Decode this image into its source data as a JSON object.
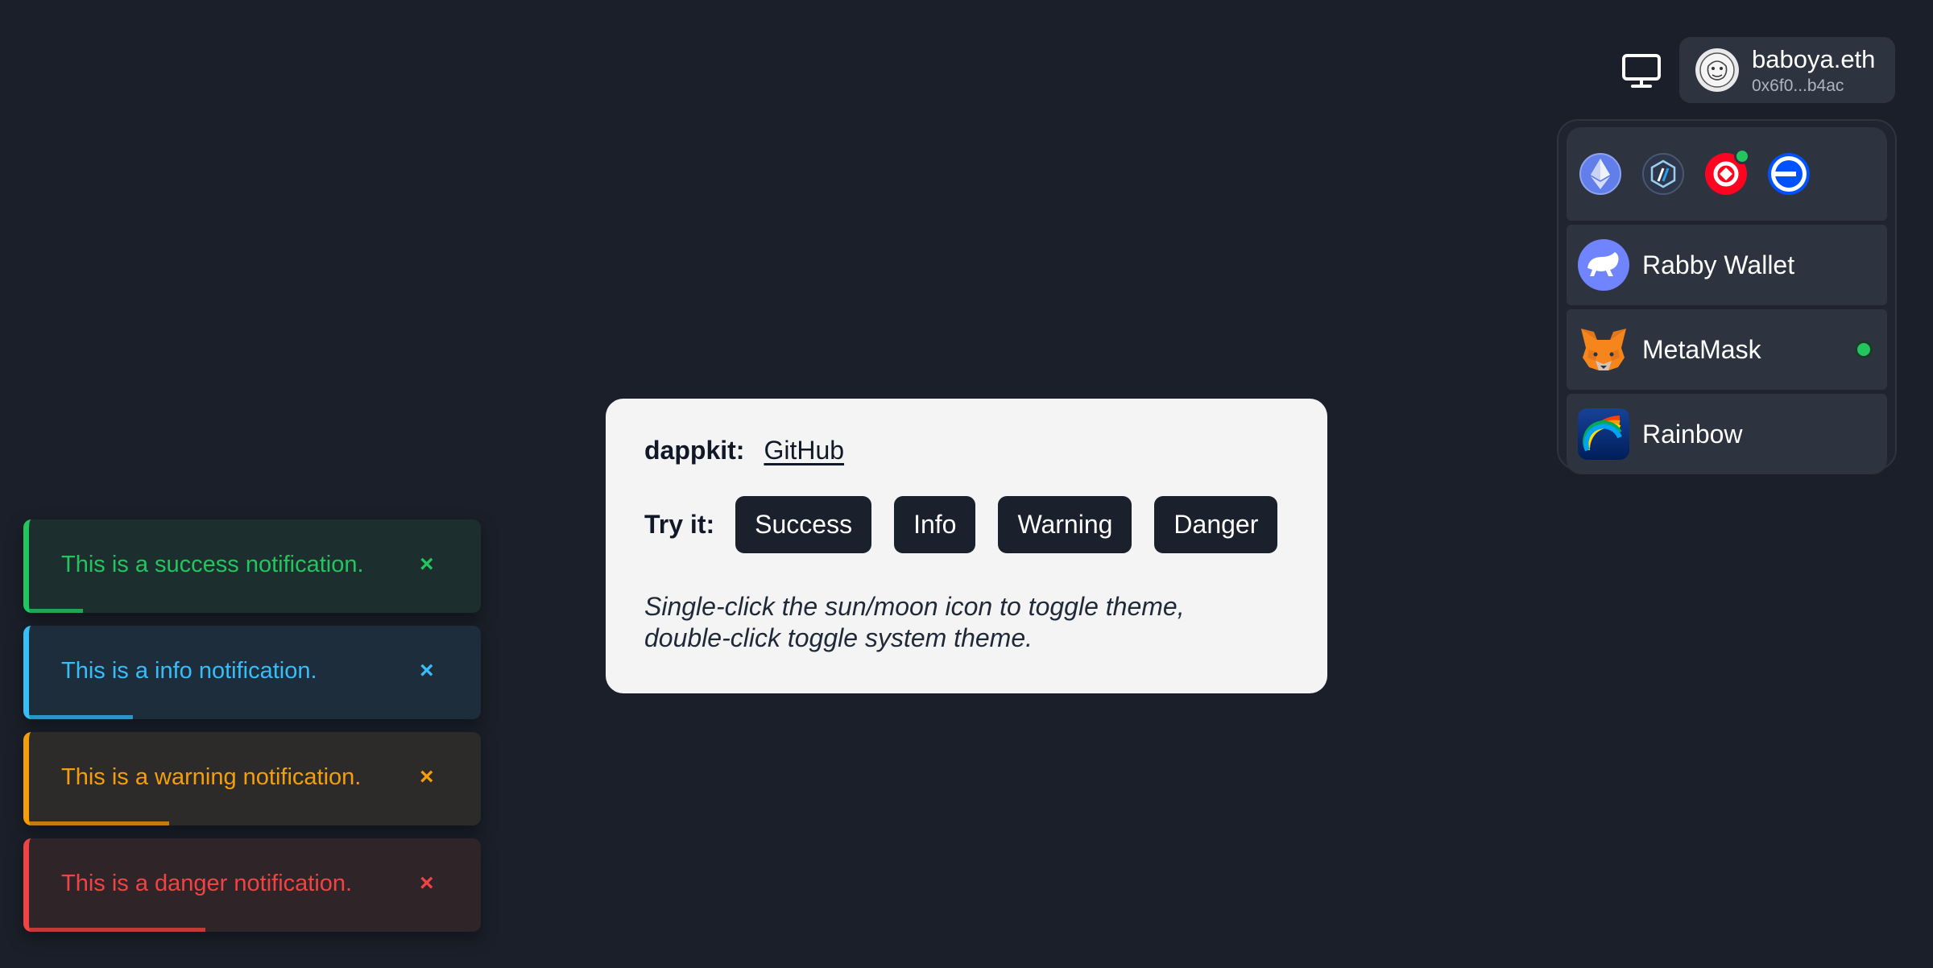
{
  "header": {
    "display_icon": "monitor-icon",
    "account": {
      "name": "baboya.eth",
      "address": "0x6f0...b4ac",
      "avatar_icon": "avatar-icon"
    }
  },
  "wallet_panel": {
    "chains": [
      {
        "name": "ethereum-icon",
        "color": "#627eea",
        "active": false
      },
      {
        "name": "arbitrum-icon",
        "color": "#2d374b",
        "active": false
      },
      {
        "name": "optimism-icon",
        "color": "#ff0420",
        "active": true
      },
      {
        "name": "base-icon",
        "color": "#0052ff",
        "active": false
      }
    ],
    "wallets": [
      {
        "label": "Rabby Wallet",
        "icon": "rabby-icon",
        "connected": false
      },
      {
        "label": "MetaMask",
        "icon": "metamask-icon",
        "connected": true
      },
      {
        "label": "Rainbow",
        "icon": "rainbow-icon",
        "connected": false
      }
    ]
  },
  "card": {
    "brand": "dappkit:",
    "link": "GitHub",
    "try_label": "Try it:",
    "buttons": [
      "Success",
      "Info",
      "Warning",
      "Danger"
    ],
    "hint_line1": "Single-click the sun/moon icon to toggle theme,",
    "hint_line2": "double-click toggle system theme."
  },
  "toasts": [
    {
      "type": "success",
      "message": "This is a success notification.",
      "close": "×",
      "progress": 0.12,
      "color": "#22c55e"
    },
    {
      "type": "info",
      "message": "This is a info notification.",
      "close": "×",
      "progress": 0.23,
      "color": "#38bdf8"
    },
    {
      "type": "warning",
      "message": "This is a warning notification.",
      "close": "×",
      "progress": 0.31,
      "color": "#f59e0b"
    },
    {
      "type": "danger",
      "message": "This is a danger notification.",
      "close": "×",
      "progress": 0.39,
      "color": "#ef4444"
    }
  ]
}
